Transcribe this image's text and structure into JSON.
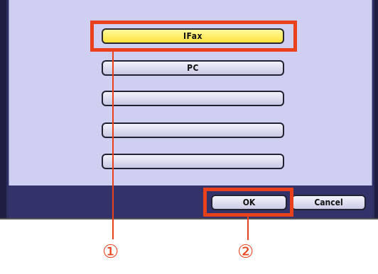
{
  "destinations": [
    {
      "label": "IFax",
      "selected": true
    },
    {
      "label": "PC",
      "selected": false
    },
    {
      "label": "",
      "selected": false
    },
    {
      "label": "",
      "selected": false
    },
    {
      "label": "",
      "selected": false
    }
  ],
  "actions": {
    "ok_label": "OK",
    "cancel_label": "Cancel"
  },
  "callouts": {
    "one": "①",
    "two": "②"
  },
  "colors": {
    "highlight": "#e8411c",
    "selected_button": "#fff266",
    "panel_background": "#cfcff1",
    "frame_dark": "#33336a"
  }
}
